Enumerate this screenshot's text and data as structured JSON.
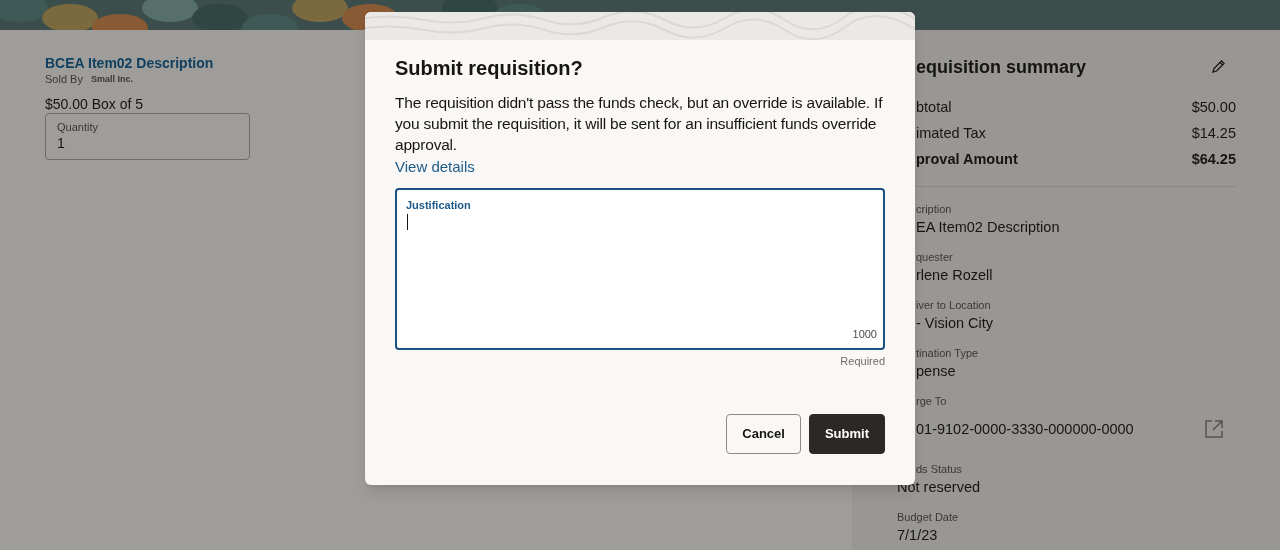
{
  "item": {
    "title": "BCEA Item02 Description",
    "sold_by_label": "Sold By",
    "supplier": "Small Inc.",
    "price": "$50.00 Box of 5",
    "quantity": {
      "label": "Quantity",
      "value": "1"
    }
  },
  "summary": {
    "title": "equisition summary",
    "totals": [
      {
        "label": "btotal",
        "value": "$50.00",
        "bold": false
      },
      {
        "label": "imated Tax",
        "value": "$14.25",
        "bold": false
      },
      {
        "label": "proval Amount",
        "value": "$64.25",
        "bold": true
      }
    ],
    "fields": [
      {
        "label": "cription",
        "value": "EA Item02 Description",
        "kind": "text"
      },
      {
        "label": "quester",
        "value": "rlene Rozell",
        "kind": "text"
      },
      {
        "label": "iver to Location",
        "value": "- Vision City",
        "kind": "text"
      },
      {
        "label": "tination Type",
        "value": "pense",
        "kind": "text"
      },
      {
        "label": "rge To",
        "value": "01-9102-0000-3330-000000-0000",
        "kind": "link"
      },
      {
        "label": "ds Status",
        "value": "Not reserved",
        "kind": "text"
      },
      {
        "label": "Budget Date",
        "value": "7/1/23",
        "kind": "text"
      }
    ]
  },
  "dialog": {
    "title": "Submit requisition?",
    "message": "The requisition didn't pass the funds check, but an override is available. If you submit the requisition, it will be sent for an insufficient funds override approval.",
    "link": "View details",
    "justification": {
      "label": "Justification",
      "counter": "1000",
      "helper": "Required",
      "focused": true
    },
    "buttons": [
      {
        "label": "Cancel",
        "kind": "secondary"
      },
      {
        "label": "Submit",
        "kind": "primary"
      }
    ]
  }
}
